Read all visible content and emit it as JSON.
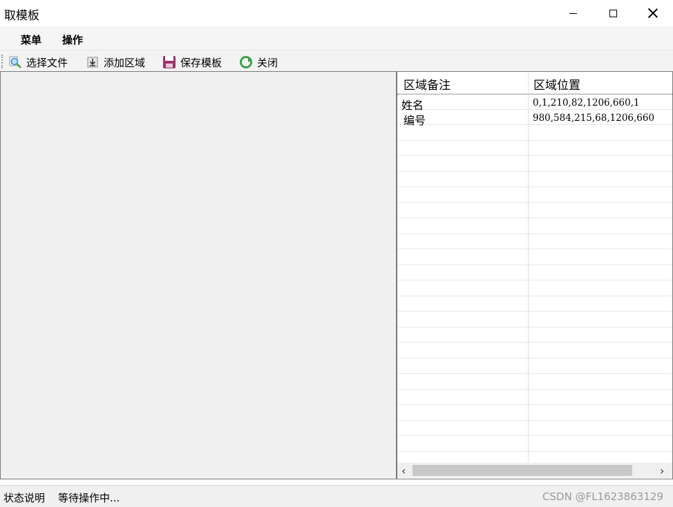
{
  "window": {
    "title": "取模板"
  },
  "menubar": {
    "items": [
      "菜单",
      "操作"
    ]
  },
  "toolbar": {
    "select_file": "选择文件",
    "add_region": "添加区域",
    "save_template": "保存模板",
    "close": "关闭"
  },
  "table": {
    "headers": [
      "区域备注",
      "区域位置"
    ],
    "rows": [
      {
        "note": "姓名",
        "pos": "0,1,210,82,1206,660,1"
      },
      {
        "note": "编号",
        "pos": "980,584,215,68,1206,660"
      }
    ]
  },
  "statusbar": {
    "label": "状态说明",
    "text": "等待操作中...",
    "watermark": "CSDN @FL1623863129"
  },
  "colors": {
    "save_icon": "#a0306a",
    "close_icon": "#3aa04a",
    "search_icon": "#3a8bd6"
  }
}
